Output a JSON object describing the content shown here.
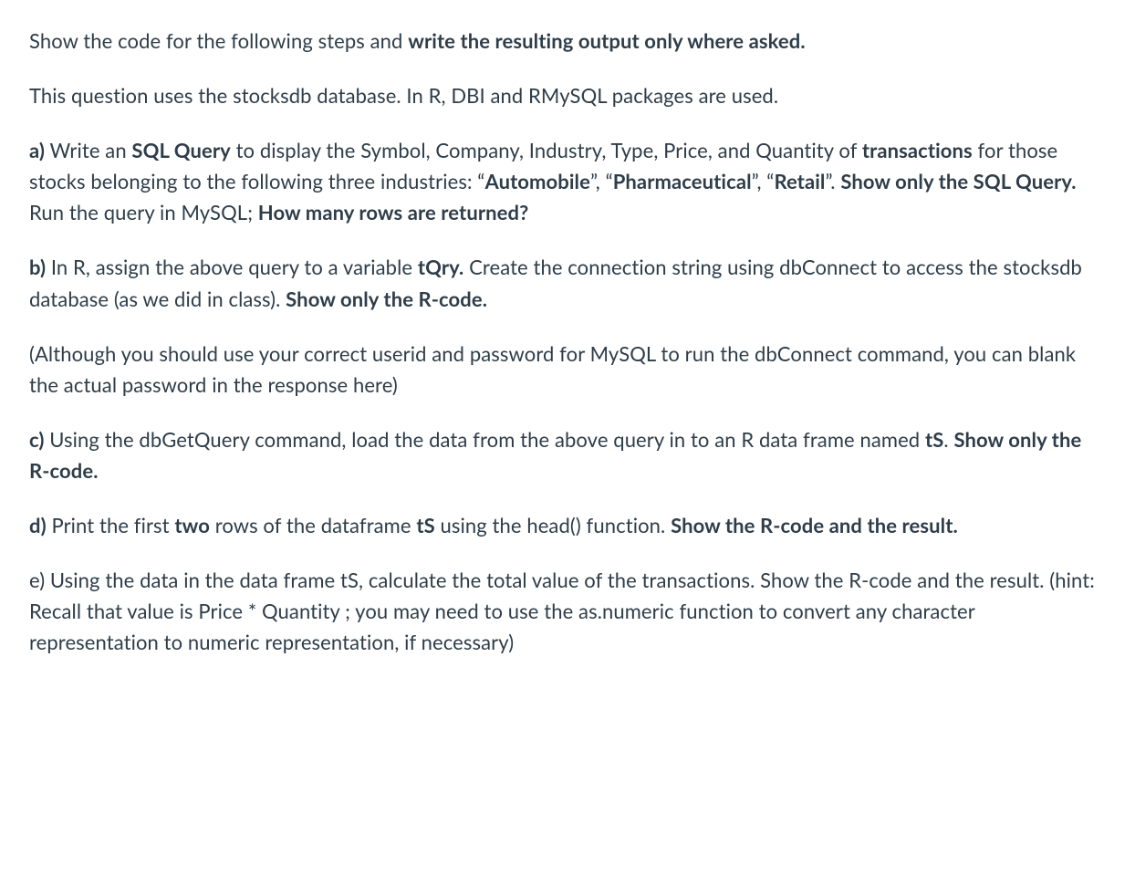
{
  "intro": {
    "line1_part1": " Show the code for the following steps and ",
    "line1_bold": "write the resulting output only where asked.",
    "line2": "This question uses the stocksdb database.   In R, DBI and RMySQL packages  are used."
  },
  "a": {
    "label": "a)",
    "t1": " Write an ",
    "b1": "SQL Query",
    "t2": " to display the Symbol, Company, Industry, Type, Price, and Quantity  of ",
    "b2": "transactions",
    "t3": " for those stocks belonging to the following three industries: “",
    "b3": "Automobile",
    "t4": "”, “",
    "b4": "Pharmaceutical",
    "t5": "”, “",
    "b5": "Retail",
    "t6": "”.   ",
    "b6": "Show only the SQL Query.",
    "t7": "  Run the query in MySQL;  ",
    "b7": "How many rows are returned?"
  },
  "b": {
    "label": "b)",
    "t1": " In R, assign the above query to a variable ",
    "b1": "tQry.",
    "t2": "  Create the connection string using dbConnect to access the stocksdb database (as we did in class).  ",
    "b2": "Show only the R-code."
  },
  "bnote": {
    "t1": "(Although you should use your correct userid and password for MySQL to run the dbConnect command, you can blank the actual password in the response here)"
  },
  "c": {
    "label": "c)",
    "t1": " Using the dbGetQuery command, load the data from the above query in to an R data frame named ",
    "b1": "tS",
    "t2": ".  ",
    "b2": "Show only the R-code."
  },
  "d": {
    "label": "d)",
    "t1": " Print the first ",
    "b1": "two",
    "t2": " rows of the dataframe ",
    "b2": "tS",
    "t3": " using the head() function.  ",
    "b3": "Show the R-code and the result."
  },
  "e": {
    "t1": "e) Using the data in the data frame tS, calculate the total  value of the transactions. Show the R-code and the result.  (hint: Recall that value is Price * Quantity ; you may need to use the as.numeric function to convert any character representation to numeric representation, if necessary)"
  }
}
